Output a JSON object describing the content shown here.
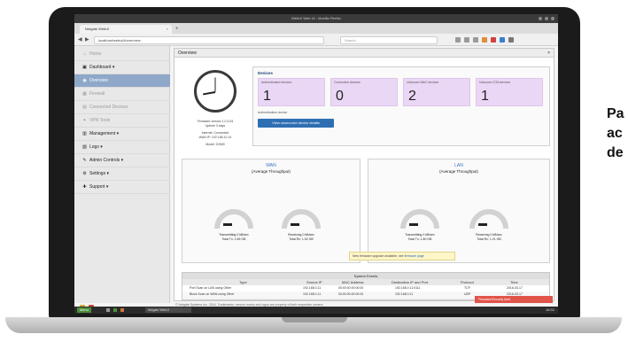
{
  "browser": {
    "window_title": "WebUI Web UI - Mozilla Firefox",
    "tab_title": "Netgate WebUI",
    "tab_close": "×",
    "new_tab": "+",
    "url": "localhost/webui/#/overview",
    "search_placeholder": "Search"
  },
  "caption": [
    "Pa",
    "ac",
    "de"
  ],
  "sidebar": {
    "items": [
      {
        "label": "Home",
        "icon": "home-icon",
        "state": "dim"
      },
      {
        "label": "Dashboard ▾",
        "icon": "dashboard-icon",
        "state": "normal"
      },
      {
        "label": "Overview",
        "icon": "overview-icon",
        "state": "active"
      },
      {
        "label": "Firewall",
        "icon": "firewall-icon",
        "state": "dim"
      },
      {
        "label": "Connected Devices",
        "icon": "devices-icon",
        "state": "dim"
      },
      {
        "label": "VPN Tools",
        "icon": "vpn-icon",
        "state": "dim"
      },
      {
        "label": "Management ▾",
        "icon": "management-icon",
        "state": "normal"
      },
      {
        "label": "Logs ▾",
        "icon": "logs-icon",
        "state": "normal"
      },
      {
        "label": "Admin Controls ▾",
        "icon": "admin-icon",
        "state": "normal"
      },
      {
        "label": "Settings ▾",
        "icon": "settings-icon",
        "state": "normal"
      },
      {
        "label": "Support ▾",
        "icon": "support-icon",
        "state": "normal"
      }
    ]
  },
  "overview": {
    "title": "Overview",
    "close": "×",
    "clock_lines": [
      "Firmware version 1.0.3.53",
      "Uptime 3 days",
      "Internet: Connected",
      "WAN IP: 192.168.10.14",
      "Model: GSM0"
    ],
    "devices_title": "Devices",
    "device_cards": [
      {
        "label": "Authenticated devices",
        "value": "1"
      },
      {
        "label": "Connected devices",
        "value": "0"
      },
      {
        "label": "Unknown MAC devices",
        "value": "2"
      },
      {
        "label": "Unknown OTA devices",
        "value": "1"
      }
    ],
    "unauth_label": "Authentication device",
    "unauth_button": "View unsecured device details",
    "wan": {
      "title": "WAN",
      "subtitle": "(Average Throughput)",
      "gauges": [
        {
          "label": "Transmitting 0 kB/sec",
          "sub": "Total Tx: 1.65 GB"
        },
        {
          "label": "Receiving 0 kB/sec",
          "sub": "Total Rx: 1.92 GB"
        }
      ]
    },
    "lan": {
      "title": "LAN",
      "subtitle": "(Average Throughput)",
      "gauges": [
        {
          "label": "Transmitting 0 kB/sec",
          "sub": "Total Tx: 1.80 GB"
        },
        {
          "label": "Receiving 0 kB/sec",
          "sub": "Total Rx: 1.21 GB"
        }
      ]
    }
  },
  "events": {
    "title": "System Events",
    "headers": [
      "Type",
      "Source IP",
      "MAC Address",
      "Destination IP and Port",
      "Protocol",
      "Time"
    ],
    "rows": [
      [
        "Port Scan on LAN using Other",
        "192.168.0.11",
        "00:00:00:00:00:00",
        "192.168.0.11:0111",
        "TCP",
        "2016-03-17"
      ],
      [
        "Block Scan on WAN using Other",
        "192.168.0.11",
        "00:00:00:00:00:00",
        "192.168.0.11",
        "UDP",
        "2016-03-17"
      ]
    ]
  },
  "notices": {
    "firmware_text": "New firmware upgrade available, see",
    "firmware_link": "firmware page",
    "red_text": "Firmware/Security Alert",
    "footer": "© Netgate Systems Inc. 2016. Trademarks, service marks and logos are property of their respective owners."
  },
  "taskbar": {
    "menu": "Menu",
    "task": "Netgate WebUI",
    "clock": "16:52"
  },
  "colors": {
    "accent": "#2e6fb3",
    "active_nav": "#8fa8c9",
    "card": "#ead7f5",
    "alert": "#e1544a"
  }
}
